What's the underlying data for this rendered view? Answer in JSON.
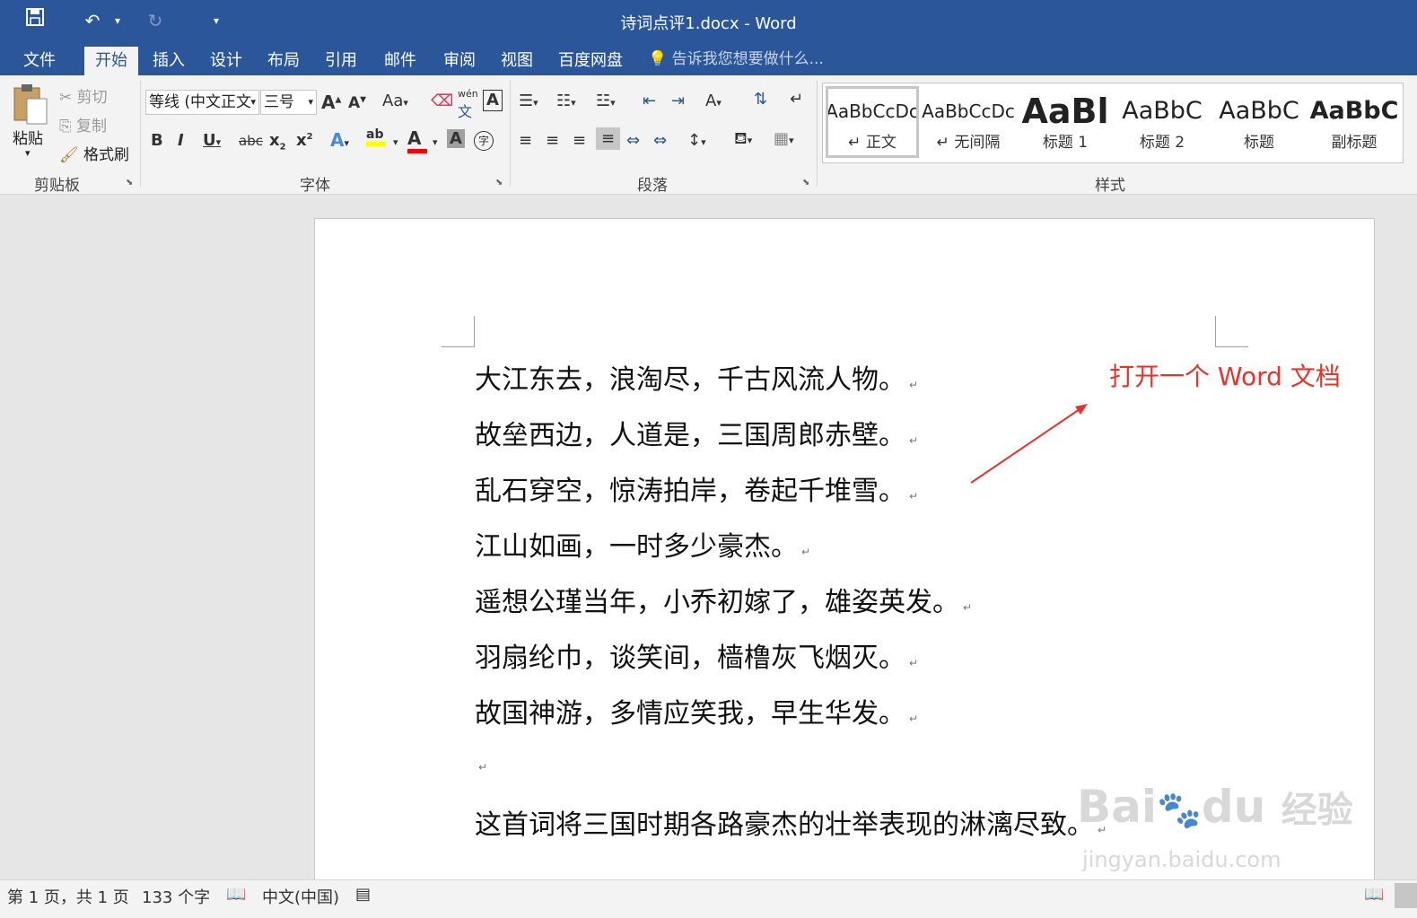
{
  "window": {
    "title": "诗词点评1.docx - Word"
  },
  "qat": {
    "save_icon": "save-icon",
    "undo_icon": "undo-icon",
    "redo_icon": "redo-icon",
    "customize_icon": "customize-qat-icon"
  },
  "tabs": [
    {
      "label": "文件"
    },
    {
      "label": "开始",
      "active": true
    },
    {
      "label": "插入"
    },
    {
      "label": "设计"
    },
    {
      "label": "布局"
    },
    {
      "label": "引用"
    },
    {
      "label": "邮件"
    },
    {
      "label": "审阅"
    },
    {
      "label": "视图"
    },
    {
      "label": "百度网盘"
    }
  ],
  "tellme": {
    "text": "告诉我您想要做什么..."
  },
  "clipboard": {
    "paste": "粘贴",
    "cut": "剪切",
    "copy": "复制",
    "format_painter": "格式刷",
    "label": "剪贴板"
  },
  "font": {
    "name": "等线 (中文正文",
    "size": "三号",
    "label": "字体",
    "grow": "A",
    "shrink": "A",
    "case": "Aa",
    "phonetic": "wén",
    "bold": "B",
    "italic": "I",
    "underline": "U",
    "strike": "abc",
    "subscript": "x",
    "superscript": "x",
    "effects": "A",
    "highlight": "ab",
    "color": "A",
    "shading": "A",
    "enclose": "字",
    "highlight_color": "#ffff00",
    "font_color": "#ff0000"
  },
  "paragraph": {
    "label": "段落"
  },
  "styles": {
    "label": "样式",
    "items": [
      {
        "preview": "AaBbCcDc",
        "name": "正文",
        "selected": true
      },
      {
        "preview": "AaBbCcDc",
        "name": "无间隔"
      },
      {
        "preview": "AaBl",
        "name": "标题 1"
      },
      {
        "preview": "AaBbC",
        "name": "标题 2"
      },
      {
        "preview": "AaBbC",
        "name": "标题"
      },
      {
        "preview": "AaBbC",
        "name": "副标题"
      }
    ]
  },
  "document": {
    "lines": [
      "大江东去，浪淘尽，千古风流人物。",
      "故垒西边，人道是，三国周郎赤壁。",
      "乱石穿空，惊涛拍岸，卷起千堆雪。",
      "江山如画，一时多少豪杰。",
      "遥想公瑾当年，小乔初嫁了，雄姿英发。",
      "羽扇纶巾，谈笑间，樯橹灰飞烟灭。",
      "故国神游，多情应笑我，早生华发。",
      "",
      "这首词将三国时期各路豪杰的壮举表现的淋漓尽致。"
    ],
    "paragraph_mark": "↵"
  },
  "annotation": {
    "text": "打开一个 Word 文档",
    "color": "#e8332b"
  },
  "watermark": {
    "brand": "Bai",
    "brand2": "du",
    "brand3": "经验",
    "url": "jingyan.baidu.com"
  },
  "status": {
    "page": "第 1 页，共 1 页",
    "words": "133 个字",
    "language": "中文(中国)"
  },
  "colors": {
    "accent": "#2b579a"
  }
}
